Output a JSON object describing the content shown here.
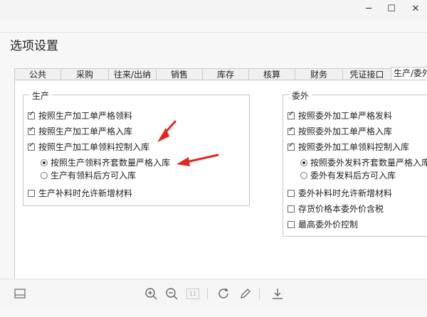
{
  "window": {
    "controls": [
      "─",
      "☐",
      "✕"
    ]
  },
  "page_title": "选项设置",
  "tabs": [
    "公共",
    "采购",
    "往来/出纳",
    "销售",
    "库存",
    "核算",
    "财务",
    "凭证接口",
    "生产/委外"
  ],
  "active_tab": 8,
  "production": {
    "title": "生产",
    "checks": [
      {
        "label": "按照生产加工单严格领料",
        "checked": true
      },
      {
        "label": "按照生产加工单严格入库",
        "checked": true
      },
      {
        "label": "按照生产加工单领料控制入库",
        "checked": true
      }
    ],
    "radios": [
      {
        "label": "按照生产领料齐套数量严格入库",
        "checked": true
      },
      {
        "label": "生产有领料后方可入库",
        "checked": false
      }
    ],
    "extra_check": {
      "label": "生产补料时允许新增材料",
      "checked": false
    }
  },
  "outsource": {
    "title": "委外",
    "checks": [
      {
        "label": "按照委外加工单严格发料",
        "checked": true
      },
      {
        "label": "按照委外加工单严格入库",
        "checked": true
      },
      {
        "label": "按照委外加工单领料控制入库",
        "checked": true
      }
    ],
    "radios": [
      {
        "label": "按照委外发料齐套数量严格入库",
        "checked": true
      },
      {
        "label": "委外有发料后方可入库",
        "checked": false
      }
    ],
    "extra_checks": [
      {
        "label": "委外补料时允许新增材料",
        "checked": false
      },
      {
        "label": "存货价格本委外价含税",
        "checked": false
      },
      {
        "label": "最高委外价控制",
        "checked": false
      }
    ]
  },
  "toolbar": {
    "page_number": "11"
  },
  "colors": {
    "arrow": "#e02a20"
  }
}
